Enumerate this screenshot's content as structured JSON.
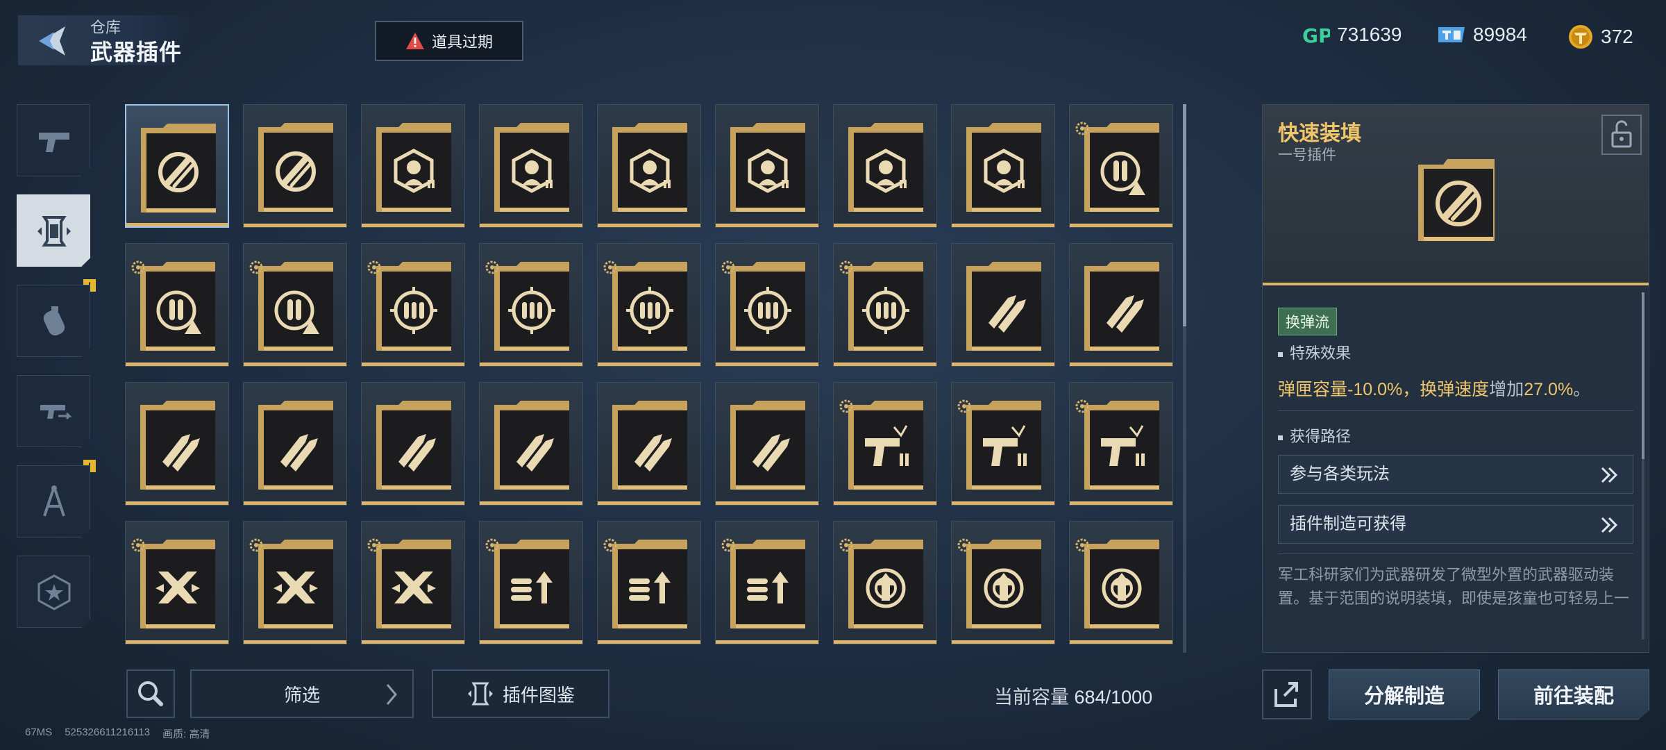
{
  "header": {
    "breadcrumb": "仓库",
    "title": "武器插件",
    "expire_label": "道具过期"
  },
  "currencies": [
    {
      "icon": "gp-icon",
      "value": "731639"
    },
    {
      "icon": "ticket-icon",
      "value": "89984"
    },
    {
      "icon": "token-icon",
      "value": "372"
    }
  ],
  "nav": {
    "tabs": [
      "pistol-icon",
      "plugin-icon",
      "grenade-icon",
      "weapon-swap-icon",
      "compass-icon",
      "star-badge-icon"
    ],
    "active_index": 1,
    "badges": [
      2,
      4
    ]
  },
  "grid": {
    "rows": [
      [
        "reload",
        "reload",
        "headshot",
        "headshot",
        "headshot",
        "headshot",
        "headshot",
        "headshot",
        "ammo-warning"
      ],
      [
        "ammo-warning",
        "ammo-warning",
        "target-ammo",
        "target-ammo",
        "target-ammo",
        "target-ammo",
        "target-ammo",
        "rockets",
        "rockets"
      ],
      [
        "rockets",
        "rockets",
        "rockets",
        "rockets",
        "rockets",
        "rockets",
        "gun-ammo",
        "gun-ammo",
        "gun-ammo"
      ],
      [
        "shield-x",
        "shield-x",
        "shield-x",
        "ammo-up",
        "ammo-up",
        "ammo-up",
        "target-up",
        "target-up",
        "target-up"
      ]
    ],
    "gear_marked": [
      [
        false,
        false,
        false,
        false,
        false,
        false,
        false,
        false,
        true
      ],
      [
        true,
        true,
        true,
        true,
        true,
        true,
        true,
        false,
        false
      ],
      [
        false,
        false,
        false,
        false,
        false,
        false,
        true,
        true,
        true
      ],
      [
        true,
        true,
        true,
        true,
        true,
        true,
        true,
        true,
        true
      ]
    ],
    "selected": [
      0,
      0
    ]
  },
  "bottom": {
    "filter_label": "筛选",
    "guide_label": "插件图鉴",
    "capacity_label": "当前容量",
    "capacity_value": "684/1000",
    "debug_ms": "67MS",
    "debug_id": "525326611216113",
    "debug_quality": "画质: 高清"
  },
  "detail": {
    "name": "快速装填",
    "slot": "一号插件",
    "tag": "换弹流",
    "effects_heading": "特殊效果",
    "effect": {
      "part1": "弹匣容量",
      "val1": "-10.0%",
      "sep": "，",
      "part2": "换弹速度",
      "verb": "增加",
      "val2": "27.0%",
      "end": "。"
    },
    "source_heading": "获得路径",
    "sources": [
      "参与各类玩法",
      "插件制造可获得"
    ],
    "description": "军工科研家们为武器研发了微型外置的武器驱动装置。基于范围的说明装填，即使是孩童也可轻易上一"
  },
  "actions": {
    "dismantle": "分解制造",
    "equip": "前往装配"
  }
}
